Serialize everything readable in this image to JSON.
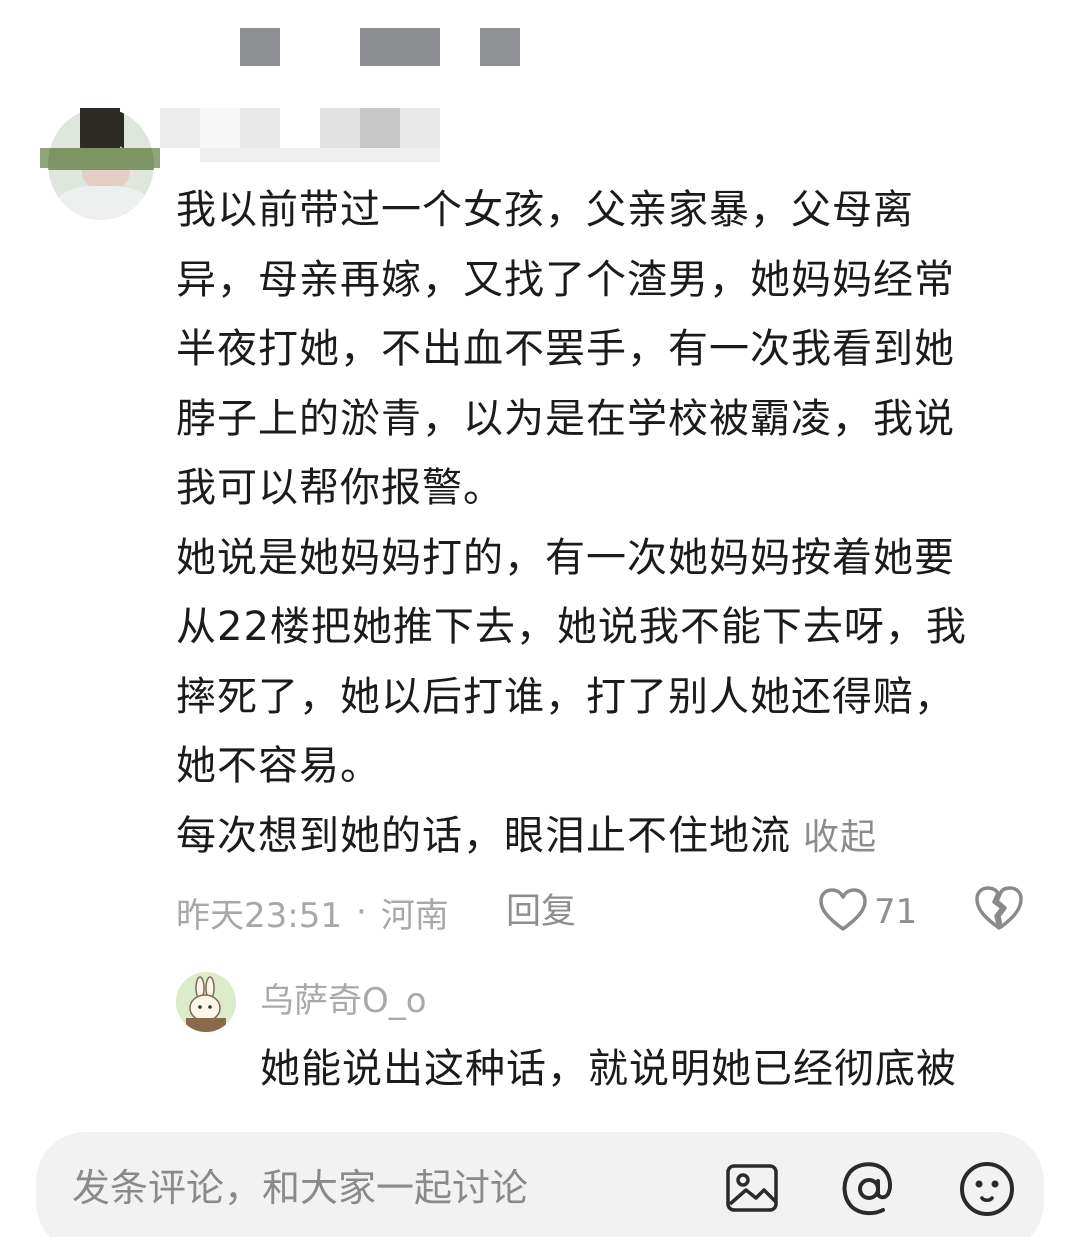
{
  "comment": {
    "paragraphs": [
      "我以前带过一个女孩，父亲家暴，父母离异，母亲再嫁，又找了个渣男，她妈妈经常半夜打她，不出血不罢手，有一次我看到她脖子上的淤青，以为是在学校被霸凌，我说我可以帮你报警。",
      "她说是她妈妈打的，有一次她妈妈按着她要从22楼把她推下去，她说我不能下去呀，我摔死了，她以后打谁，打了别人她还得赔，她不容易。",
      "每次想到她的话，眼泪止不住地流"
    ],
    "lines": [
      "我以前带过一个女孩，父亲家暴，父母离",
      "异，母亲再嫁，又找了个渣男，她妈妈经常",
      "半夜打她，不出血不罢手，有一次我看到她",
      "脖子上的淤青，以为是在学校被霸凌，我说",
      "我可以帮你报警。",
      "她说是她妈妈打的，有一次她妈妈按着她要",
      "从22楼把她推下去，她说我不能下去呀，我",
      "摔死了，她以后打谁，打了别人她还得赔，",
      "她不容易。",
      "每次想到她的话，眼泪止不住地流"
    ],
    "collapse_label": "收起",
    "time": "昨天23:51",
    "separator": "·",
    "location": "河南",
    "reply_label": "回复",
    "like_count": "71"
  },
  "reply": {
    "username": "乌萨奇O_o",
    "text": "她能说出这种话，就说明她已经彻底被"
  },
  "composer": {
    "placeholder": "发条评论，和大家一起讨论"
  },
  "icons": {
    "like": "heart-outline-icon",
    "dislike": "broken-heart-icon",
    "image": "image-icon",
    "mention": "at-icon",
    "emoji": "emoji-icon"
  },
  "colors": {
    "text": "#1b1b1b",
    "muted": "#a8a8a8",
    "bar_bg": "#f2f2f2"
  }
}
